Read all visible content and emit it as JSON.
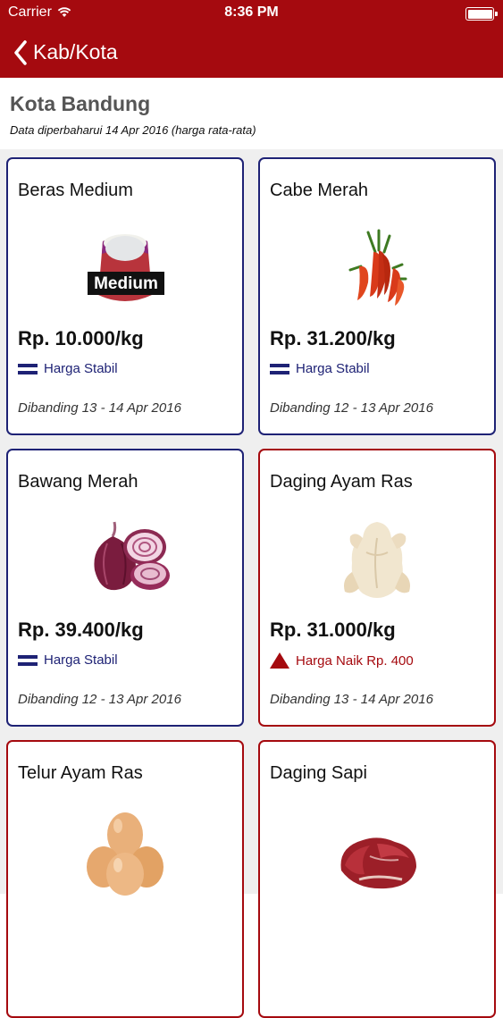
{
  "status_bar": {
    "carrier": "Carrier",
    "time": "8:36 PM"
  },
  "nav": {
    "back_label": "Kab/Kota"
  },
  "header": {
    "city": "Kota Bandung",
    "updated": "Data diperbaharui 14 Apr 2016 (harga rata-rata)"
  },
  "colors": {
    "primary": "#a50a0f",
    "stable": "#1e2275",
    "up": "#a50a0f"
  },
  "cards": [
    {
      "name": "Beras Medium",
      "image_label": "Medium",
      "price": "Rp. 10.000/kg",
      "trend": "stable",
      "status": "Harga Stabil",
      "compare": "Dibanding 13 - 14 Apr 2016"
    },
    {
      "name": "Cabe Merah",
      "price": "Rp. 31.200/kg",
      "trend": "stable",
      "status": "Harga Stabil",
      "compare": "Dibanding 12 - 13 Apr 2016"
    },
    {
      "name": "Bawang Merah",
      "price": "Rp. 39.400/kg",
      "trend": "stable",
      "status": "Harga Stabil",
      "compare": "Dibanding 12 - 13 Apr 2016"
    },
    {
      "name": "Daging Ayam Ras",
      "price": "Rp. 31.000/kg",
      "trend": "up",
      "status": "Harga Naik Rp. 400",
      "compare": "Dibanding 13 - 14 Apr 2016"
    },
    {
      "name": "Telur Ayam Ras"
    },
    {
      "name": "Daging Sapi"
    }
  ]
}
